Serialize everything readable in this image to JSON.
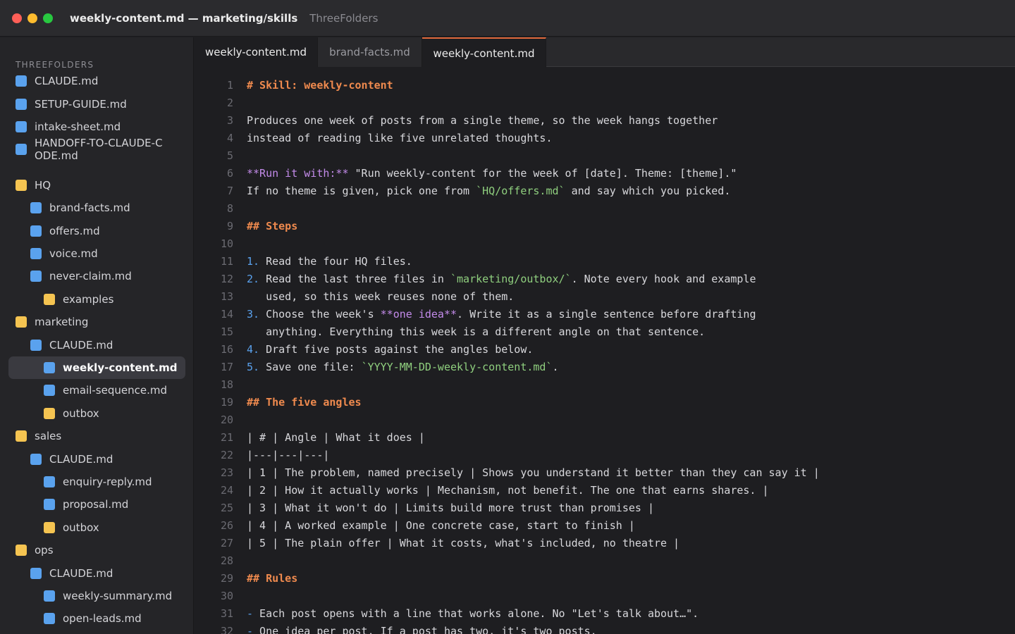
{
  "window": {
    "title": "weekly-content.md — marketing/skills",
    "subtitle": "ThreeFolders"
  },
  "sidebar": {
    "heading": "THREEFOLDERS",
    "items": [
      {
        "label": "CLAUDE.md",
        "type": "file",
        "depth": 0
      },
      {
        "label": "SETUP-GUIDE.md",
        "type": "file",
        "depth": 0
      },
      {
        "label": "intake-sheet.md",
        "type": "file",
        "depth": 0
      },
      {
        "label": "HANDOFF-TO-CLAUDE-CODE.md",
        "type": "file",
        "depth": 0
      },
      {
        "label": "HQ",
        "type": "folder",
        "depth": 0
      },
      {
        "label": "brand-facts.md",
        "type": "file",
        "depth": 1
      },
      {
        "label": "offers.md",
        "type": "file",
        "depth": 1
      },
      {
        "label": "voice.md",
        "type": "file",
        "depth": 1
      },
      {
        "label": "never-claim.md",
        "type": "file",
        "depth": 1
      },
      {
        "label": "examples",
        "type": "folder",
        "depth": 2
      },
      {
        "label": "marketing",
        "type": "folder",
        "depth": 0
      },
      {
        "label": "CLAUDE.md",
        "type": "file",
        "depth": 1
      },
      {
        "label": "weekly-content.md",
        "type": "file",
        "depth": 2,
        "active": true
      },
      {
        "label": "email-sequence.md",
        "type": "file",
        "depth": 2
      },
      {
        "label": "outbox",
        "type": "folder",
        "depth": 2
      },
      {
        "label": "sales",
        "type": "folder",
        "depth": 0
      },
      {
        "label": "CLAUDE.md",
        "type": "file",
        "depth": 1
      },
      {
        "label": "enquiry-reply.md",
        "type": "file",
        "depth": 2
      },
      {
        "label": "proposal.md",
        "type": "file",
        "depth": 2
      },
      {
        "label": "outbox",
        "type": "folder",
        "depth": 2
      },
      {
        "label": "ops",
        "type": "folder",
        "depth": 0
      },
      {
        "label": "CLAUDE.md",
        "type": "file",
        "depth": 1
      },
      {
        "label": "weekly-summary.md",
        "type": "file",
        "depth": 2
      },
      {
        "label": "open-leads.md",
        "type": "file",
        "depth": 2
      }
    ]
  },
  "tabs": [
    {
      "label": "weekly-content.md"
    },
    {
      "label": "brand-facts.md"
    },
    {
      "label": "weekly-content.md",
      "active": true
    }
  ],
  "editor": {
    "lines": [
      [
        [
          "h",
          "# Skill: weekly-content"
        ]
      ],
      [],
      [
        [
          "t",
          "Produces one week of posts from a single theme, so the week hangs together"
        ]
      ],
      [
        [
          "t",
          "instead of reading like five unrelated thoughts."
        ]
      ],
      [],
      [
        [
          "b",
          "**Run it with:**"
        ],
        [
          "t",
          " \"Run weekly-content for the week of [date]. Theme: [theme].\""
        ]
      ],
      [
        [
          "t",
          "If no theme is given, pick one from "
        ],
        [
          "c",
          "`HQ/offers.md`"
        ],
        [
          "t",
          " and say which you picked."
        ]
      ],
      [],
      [
        [
          "h",
          "## Steps"
        ]
      ],
      [],
      [
        [
          "n",
          "1."
        ],
        [
          "t",
          " Read the four HQ files."
        ]
      ],
      [
        [
          "n",
          "2."
        ],
        [
          "t",
          " Read the last three files in "
        ],
        [
          "c",
          "`marketing/outbox/`"
        ],
        [
          "t",
          ". Note every hook and example"
        ]
      ],
      [
        [
          "t",
          "   used, so this week reuses none of them."
        ]
      ],
      [
        [
          "n",
          "3."
        ],
        [
          "t",
          " Choose the week's "
        ],
        [
          "b",
          "**one idea**"
        ],
        [
          "t",
          ". Write it as a single sentence before drafting"
        ]
      ],
      [
        [
          "t",
          "   anything. Everything this week is a different angle on that sentence."
        ]
      ],
      [
        [
          "n",
          "4."
        ],
        [
          "t",
          " Draft five posts against the angles below."
        ]
      ],
      [
        [
          "n",
          "5."
        ],
        [
          "t",
          " Save one file: "
        ],
        [
          "c",
          "`YYYY-MM-DD-weekly-content.md`"
        ],
        [
          "t",
          "."
        ]
      ],
      [],
      [
        [
          "h",
          "## The five angles"
        ]
      ],
      [],
      [
        [
          "t",
          "| # | Angle | What it does |"
        ]
      ],
      [
        [
          "t",
          "|---|---|---|"
        ]
      ],
      [
        [
          "t",
          "| 1 | The problem, named precisely | Shows you understand it better than they can say it |"
        ]
      ],
      [
        [
          "t",
          "| 2 | How it actually works | Mechanism, not benefit. The one that earns shares. |"
        ]
      ],
      [
        [
          "t",
          "| 3 | What it won't do | Limits build more trust than promises |"
        ]
      ],
      [
        [
          "t",
          "| 4 | A worked example | One concrete case, start to finish |"
        ]
      ],
      [
        [
          "t",
          "| 5 | The plain offer | What it costs, what's included, no theatre |"
        ]
      ],
      [],
      [
        [
          "h",
          "## Rules"
        ]
      ],
      [],
      [
        [
          "n",
          "-"
        ],
        [
          "t",
          " Each post opens with a line that works alone. No \"Let's talk about…\"."
        ]
      ],
      [
        [
          "n",
          "-"
        ],
        [
          "t",
          " One idea per post. If a post has two, it's two posts."
        ]
      ]
    ]
  }
}
